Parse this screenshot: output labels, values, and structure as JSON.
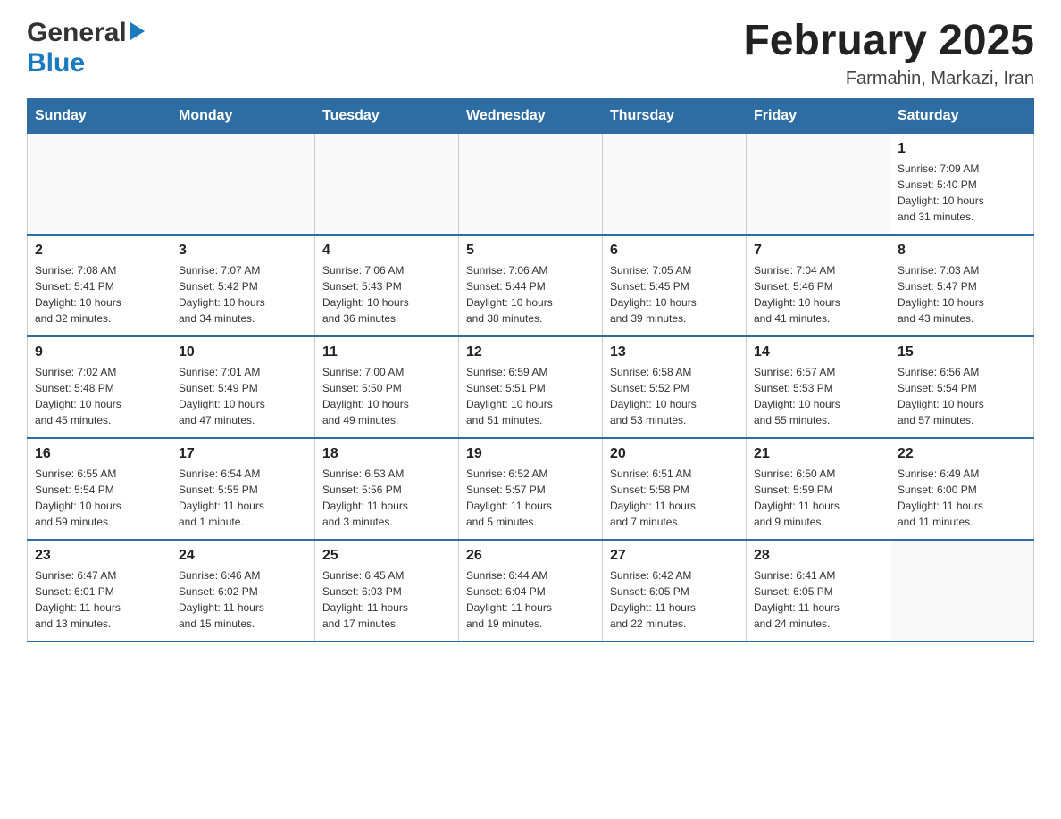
{
  "header": {
    "logo": {
      "general": "General",
      "blue": "Blue",
      "arrow": "▶"
    },
    "title": "February 2025",
    "subtitle": "Farmahin, Markazi, Iran"
  },
  "weekdays": [
    "Sunday",
    "Monday",
    "Tuesday",
    "Wednesday",
    "Thursday",
    "Friday",
    "Saturday"
  ],
  "weeks": [
    {
      "days": [
        {
          "num": "",
          "info": ""
        },
        {
          "num": "",
          "info": ""
        },
        {
          "num": "",
          "info": ""
        },
        {
          "num": "",
          "info": ""
        },
        {
          "num": "",
          "info": ""
        },
        {
          "num": "",
          "info": ""
        },
        {
          "num": "1",
          "info": "Sunrise: 7:09 AM\nSunset: 5:40 PM\nDaylight: 10 hours\nand 31 minutes."
        }
      ]
    },
    {
      "days": [
        {
          "num": "2",
          "info": "Sunrise: 7:08 AM\nSunset: 5:41 PM\nDaylight: 10 hours\nand 32 minutes."
        },
        {
          "num": "3",
          "info": "Sunrise: 7:07 AM\nSunset: 5:42 PM\nDaylight: 10 hours\nand 34 minutes."
        },
        {
          "num": "4",
          "info": "Sunrise: 7:06 AM\nSunset: 5:43 PM\nDaylight: 10 hours\nand 36 minutes."
        },
        {
          "num": "5",
          "info": "Sunrise: 7:06 AM\nSunset: 5:44 PM\nDaylight: 10 hours\nand 38 minutes."
        },
        {
          "num": "6",
          "info": "Sunrise: 7:05 AM\nSunset: 5:45 PM\nDaylight: 10 hours\nand 39 minutes."
        },
        {
          "num": "7",
          "info": "Sunrise: 7:04 AM\nSunset: 5:46 PM\nDaylight: 10 hours\nand 41 minutes."
        },
        {
          "num": "8",
          "info": "Sunrise: 7:03 AM\nSunset: 5:47 PM\nDaylight: 10 hours\nand 43 minutes."
        }
      ]
    },
    {
      "days": [
        {
          "num": "9",
          "info": "Sunrise: 7:02 AM\nSunset: 5:48 PM\nDaylight: 10 hours\nand 45 minutes."
        },
        {
          "num": "10",
          "info": "Sunrise: 7:01 AM\nSunset: 5:49 PM\nDaylight: 10 hours\nand 47 minutes."
        },
        {
          "num": "11",
          "info": "Sunrise: 7:00 AM\nSunset: 5:50 PM\nDaylight: 10 hours\nand 49 minutes."
        },
        {
          "num": "12",
          "info": "Sunrise: 6:59 AM\nSunset: 5:51 PM\nDaylight: 10 hours\nand 51 minutes."
        },
        {
          "num": "13",
          "info": "Sunrise: 6:58 AM\nSunset: 5:52 PM\nDaylight: 10 hours\nand 53 minutes."
        },
        {
          "num": "14",
          "info": "Sunrise: 6:57 AM\nSunset: 5:53 PM\nDaylight: 10 hours\nand 55 minutes."
        },
        {
          "num": "15",
          "info": "Sunrise: 6:56 AM\nSunset: 5:54 PM\nDaylight: 10 hours\nand 57 minutes."
        }
      ]
    },
    {
      "days": [
        {
          "num": "16",
          "info": "Sunrise: 6:55 AM\nSunset: 5:54 PM\nDaylight: 10 hours\nand 59 minutes."
        },
        {
          "num": "17",
          "info": "Sunrise: 6:54 AM\nSunset: 5:55 PM\nDaylight: 11 hours\nand 1 minute."
        },
        {
          "num": "18",
          "info": "Sunrise: 6:53 AM\nSunset: 5:56 PM\nDaylight: 11 hours\nand 3 minutes."
        },
        {
          "num": "19",
          "info": "Sunrise: 6:52 AM\nSunset: 5:57 PM\nDaylight: 11 hours\nand 5 minutes."
        },
        {
          "num": "20",
          "info": "Sunrise: 6:51 AM\nSunset: 5:58 PM\nDaylight: 11 hours\nand 7 minutes."
        },
        {
          "num": "21",
          "info": "Sunrise: 6:50 AM\nSunset: 5:59 PM\nDaylight: 11 hours\nand 9 minutes."
        },
        {
          "num": "22",
          "info": "Sunrise: 6:49 AM\nSunset: 6:00 PM\nDaylight: 11 hours\nand 11 minutes."
        }
      ]
    },
    {
      "days": [
        {
          "num": "23",
          "info": "Sunrise: 6:47 AM\nSunset: 6:01 PM\nDaylight: 11 hours\nand 13 minutes."
        },
        {
          "num": "24",
          "info": "Sunrise: 6:46 AM\nSunset: 6:02 PM\nDaylight: 11 hours\nand 15 minutes."
        },
        {
          "num": "25",
          "info": "Sunrise: 6:45 AM\nSunset: 6:03 PM\nDaylight: 11 hours\nand 17 minutes."
        },
        {
          "num": "26",
          "info": "Sunrise: 6:44 AM\nSunset: 6:04 PM\nDaylight: 11 hours\nand 19 minutes."
        },
        {
          "num": "27",
          "info": "Sunrise: 6:42 AM\nSunset: 6:05 PM\nDaylight: 11 hours\nand 22 minutes."
        },
        {
          "num": "28",
          "info": "Sunrise: 6:41 AM\nSunset: 6:05 PM\nDaylight: 11 hours\nand 24 minutes."
        },
        {
          "num": "",
          "info": ""
        }
      ]
    }
  ]
}
